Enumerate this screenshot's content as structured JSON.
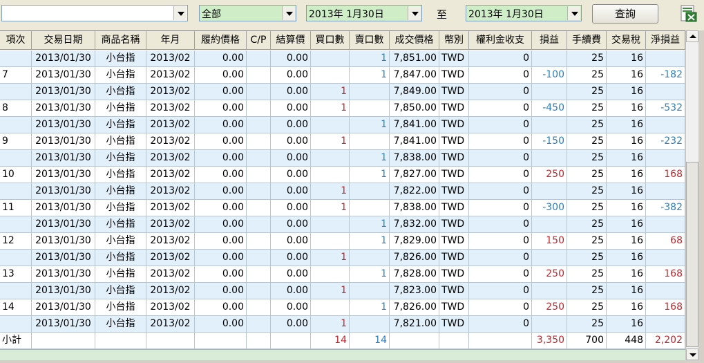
{
  "filters": {
    "account_value": "",
    "product_value": "全部",
    "date_from": "2013年  1月30日",
    "to_label": "至",
    "date_to": "2013年  1月30日",
    "query_label": "查詢",
    "colors": {
      "product_bg": "#cfeec8",
      "date_bg": "#cfeec8"
    }
  },
  "icons": {
    "export": "excel-export-icon"
  },
  "table": {
    "columns": [
      "項次",
      "交易日期",
      "商品名稱",
      "年月",
      "履約價格",
      "C/P",
      "結算價",
      "買口數",
      "賣口數",
      "成交價格",
      "幣別",
      "權利金收支",
      "損益",
      "手續費",
      "交易稅",
      "淨損益"
    ],
    "rows": [
      {
        "no": "",
        "date": "2013/01/30",
        "product": "小台指",
        "ym": "2013/02",
        "strike": "0.00",
        "cp": "",
        "settle": "0.00",
        "buy": "",
        "sell": "1",
        "price": "7,851.00",
        "cur": "TWD",
        "premium": "0",
        "pl": "",
        "fee": "25",
        "tax": "16",
        "net": ""
      },
      {
        "no": "7",
        "date": "2013/01/30",
        "product": "小台指",
        "ym": "2013/02",
        "strike": "0.00",
        "cp": "",
        "settle": "0.00",
        "buy": "",
        "sell": "1",
        "price": "7,847.00",
        "cur": "TWD",
        "premium": "0",
        "pl": "-100",
        "fee": "25",
        "tax": "16",
        "net": "-182"
      },
      {
        "no": "",
        "date": "2013/01/30",
        "product": "小台指",
        "ym": "2013/02",
        "strike": "0.00",
        "cp": "",
        "settle": "0.00",
        "buy": "1",
        "sell": "",
        "price": "7,849.00",
        "cur": "TWD",
        "premium": "0",
        "pl": "",
        "fee": "25",
        "tax": "16",
        "net": ""
      },
      {
        "no": "8",
        "date": "2013/01/30",
        "product": "小台指",
        "ym": "2013/02",
        "strike": "0.00",
        "cp": "",
        "settle": "0.00",
        "buy": "1",
        "sell": "",
        "price": "7,850.00",
        "cur": "TWD",
        "premium": "0",
        "pl": "-450",
        "fee": "25",
        "tax": "16",
        "net": "-532"
      },
      {
        "no": "",
        "date": "2013/01/30",
        "product": "小台指",
        "ym": "2013/02",
        "strike": "0.00",
        "cp": "",
        "settle": "0.00",
        "buy": "",
        "sell": "1",
        "price": "7,841.00",
        "cur": "TWD",
        "premium": "0",
        "pl": "",
        "fee": "25",
        "tax": "16",
        "net": ""
      },
      {
        "no": "9",
        "date": "2013/01/30",
        "product": "小台指",
        "ym": "2013/02",
        "strike": "0.00",
        "cp": "",
        "settle": "0.00",
        "buy": "1",
        "sell": "",
        "price": "7,841.00",
        "cur": "TWD",
        "premium": "0",
        "pl": "-150",
        "fee": "25",
        "tax": "16",
        "net": "-232"
      },
      {
        "no": "",
        "date": "2013/01/30",
        "product": "小台指",
        "ym": "2013/02",
        "strike": "0.00",
        "cp": "",
        "settle": "0.00",
        "buy": "",
        "sell": "1",
        "price": "7,838.00",
        "cur": "TWD",
        "premium": "0",
        "pl": "",
        "fee": "25",
        "tax": "16",
        "net": ""
      },
      {
        "no": "10",
        "date": "2013/01/30",
        "product": "小台指",
        "ym": "2013/02",
        "strike": "0.00",
        "cp": "",
        "settle": "0.00",
        "buy": "",
        "sell": "1",
        "price": "7,827.00",
        "cur": "TWD",
        "premium": "0",
        "pl": "250",
        "fee": "25",
        "tax": "16",
        "net": "168"
      },
      {
        "no": "",
        "date": "2013/01/30",
        "product": "小台指",
        "ym": "2013/02",
        "strike": "0.00",
        "cp": "",
        "settle": "0.00",
        "buy": "1",
        "sell": "",
        "price": "7,822.00",
        "cur": "TWD",
        "premium": "0",
        "pl": "",
        "fee": "25",
        "tax": "16",
        "net": ""
      },
      {
        "no": "11",
        "date": "2013/01/30",
        "product": "小台指",
        "ym": "2013/02",
        "strike": "0.00",
        "cp": "",
        "settle": "0.00",
        "buy": "1",
        "sell": "",
        "price": "7,838.00",
        "cur": "TWD",
        "premium": "0",
        "pl": "-300",
        "fee": "25",
        "tax": "16",
        "net": "-382"
      },
      {
        "no": "",
        "date": "2013/01/30",
        "product": "小台指",
        "ym": "2013/02",
        "strike": "0.00",
        "cp": "",
        "settle": "0.00",
        "buy": "",
        "sell": "1",
        "price": "7,832.00",
        "cur": "TWD",
        "premium": "0",
        "pl": "",
        "fee": "25",
        "tax": "16",
        "net": ""
      },
      {
        "no": "12",
        "date": "2013/01/30",
        "product": "小台指",
        "ym": "2013/02",
        "strike": "0.00",
        "cp": "",
        "settle": "0.00",
        "buy": "",
        "sell": "1",
        "price": "7,829.00",
        "cur": "TWD",
        "premium": "0",
        "pl": "150",
        "fee": "25",
        "tax": "16",
        "net": "68"
      },
      {
        "no": "",
        "date": "2013/01/30",
        "product": "小台指",
        "ym": "2013/02",
        "strike": "0.00",
        "cp": "",
        "settle": "0.00",
        "buy": "1",
        "sell": "",
        "price": "7,826.00",
        "cur": "TWD",
        "premium": "0",
        "pl": "",
        "fee": "25",
        "tax": "16",
        "net": ""
      },
      {
        "no": "13",
        "date": "2013/01/30",
        "product": "小台指",
        "ym": "2013/02",
        "strike": "0.00",
        "cp": "",
        "settle": "0.00",
        "buy": "",
        "sell": "1",
        "price": "7,828.00",
        "cur": "TWD",
        "premium": "0",
        "pl": "250",
        "fee": "25",
        "tax": "16",
        "net": "168"
      },
      {
        "no": "",
        "date": "2013/01/30",
        "product": "小台指",
        "ym": "2013/02",
        "strike": "0.00",
        "cp": "",
        "settle": "0.00",
        "buy": "1",
        "sell": "",
        "price": "7,823.00",
        "cur": "TWD",
        "premium": "0",
        "pl": "",
        "fee": "25",
        "tax": "16",
        "net": ""
      },
      {
        "no": "14",
        "date": "2013/01/30",
        "product": "小台指",
        "ym": "2013/02",
        "strike": "0.00",
        "cp": "",
        "settle": "0.00",
        "buy": "",
        "sell": "1",
        "price": "7,826.00",
        "cur": "TWD",
        "premium": "0",
        "pl": "250",
        "fee": "25",
        "tax": "16",
        "net": "168"
      },
      {
        "no": "",
        "date": "2013/01/30",
        "product": "小台指",
        "ym": "2013/02",
        "strike": "0.00",
        "cp": "",
        "settle": "0.00",
        "buy": "1",
        "sell": "",
        "price": "7,821.00",
        "cur": "TWD",
        "premium": "0",
        "pl": "",
        "fee": "25",
        "tax": "16",
        "net": ""
      }
    ],
    "subtotal": {
      "label": "小計",
      "buy": "14",
      "sell": "14",
      "pl": "3,350",
      "fee": "700",
      "tax": "448",
      "net": "2,202"
    },
    "colors": {
      "alt_row": "#e1f0fa",
      "positive": "#c0282e",
      "negative": "#2b7fc0"
    }
  }
}
